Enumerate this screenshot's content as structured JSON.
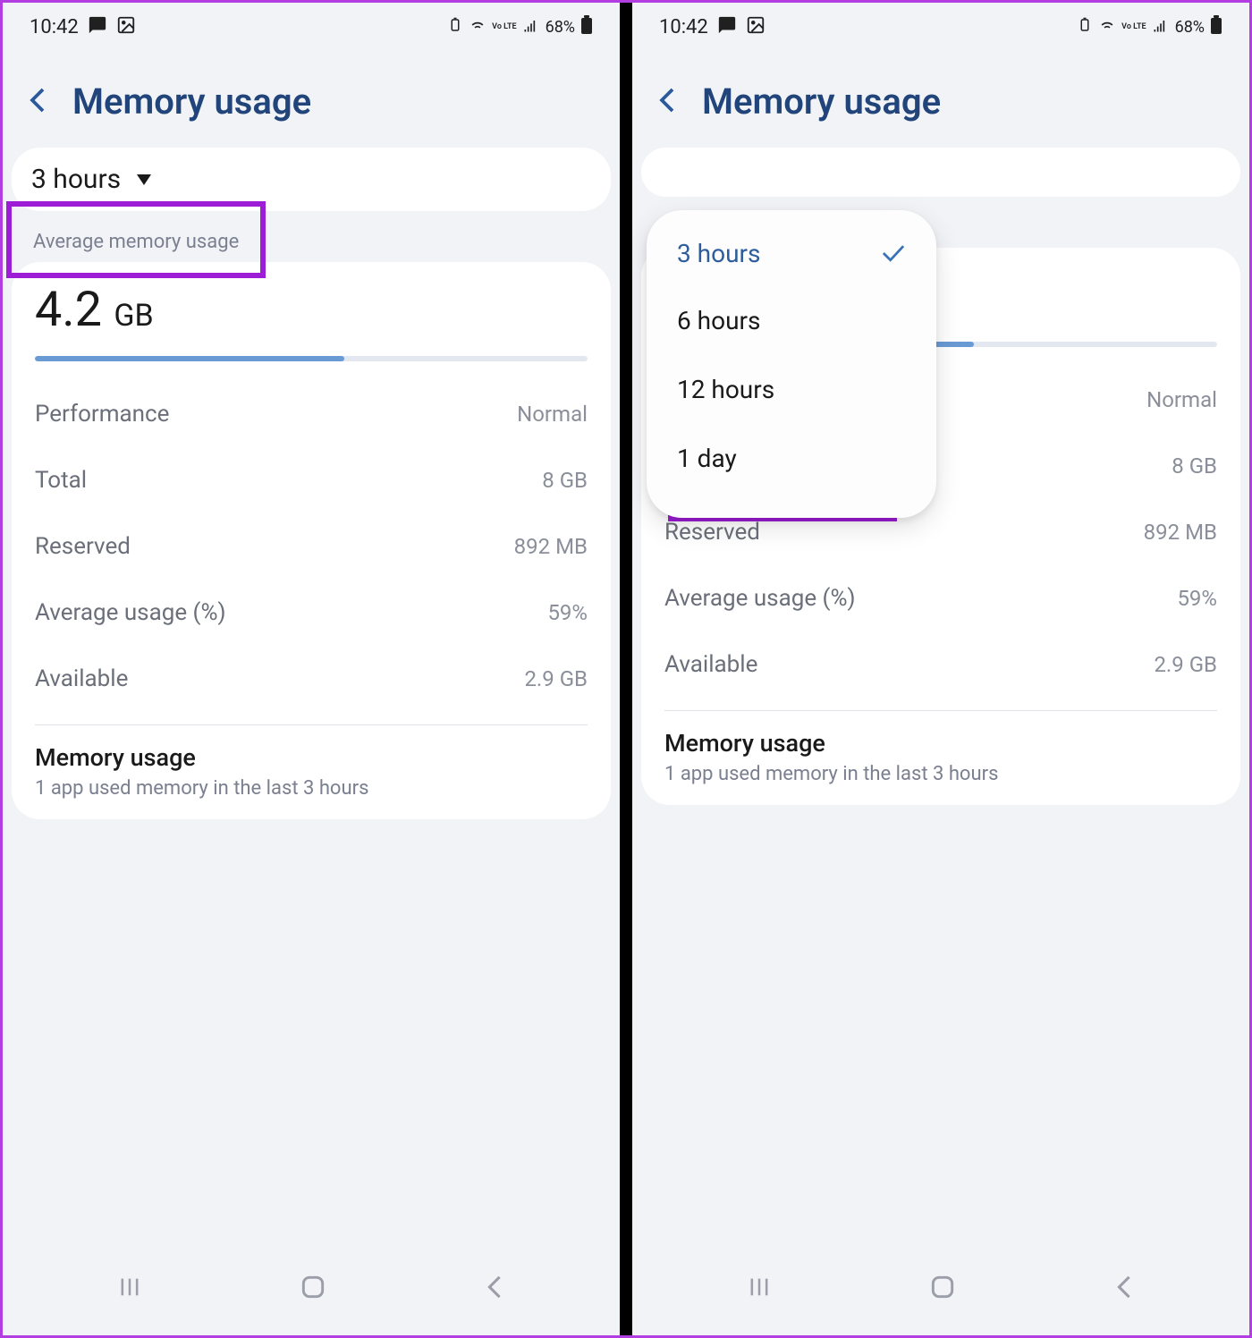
{
  "status": {
    "time": "10:42",
    "battery_pct": "68%",
    "volte": "Vo LTE"
  },
  "header": {
    "title": "Memory usage"
  },
  "dropdown": {
    "selected": "3 hours",
    "options": [
      "6 hours",
      "12 hours",
      "1 day"
    ]
  },
  "section_label": "Average memory usage",
  "usage": {
    "value": "4.2",
    "unit": "GB",
    "progress_pct": 56
  },
  "stats": {
    "performance": {
      "label": "Performance",
      "value": "Normal"
    },
    "total": {
      "label": "Total",
      "value": "8 GB"
    },
    "reserved": {
      "label": "Reserved",
      "value": "892 MB"
    },
    "avg_pct": {
      "label": "Average usage (%)",
      "value": "59%"
    },
    "available": {
      "label": "Available",
      "value": "2.9 GB"
    }
  },
  "memory_usage_section": {
    "title": "Memory usage",
    "subtitle": "1 app used memory in the last 3 hours"
  }
}
